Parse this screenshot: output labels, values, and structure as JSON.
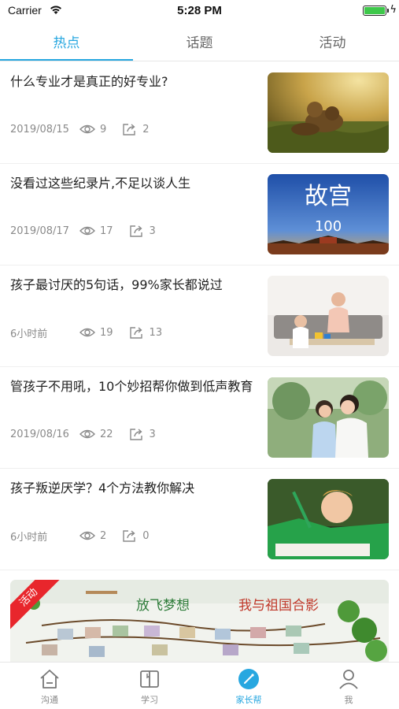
{
  "status_bar": {
    "carrier": "Carrier",
    "time": "5:28 PM",
    "battery_percent": 100,
    "battery_color": "#3ec84a"
  },
  "top_tabs": [
    {
      "label": "热点",
      "active": true
    },
    {
      "label": "话题",
      "active": false
    },
    {
      "label": "活动",
      "active": false
    }
  ],
  "accent_color": "#27a7e0",
  "articles": [
    {
      "title": "什么专业才是真正的好专业?",
      "date": "2019/08/15",
      "views": "9",
      "shares": "2",
      "image": "lions-at-sunset"
    },
    {
      "title": "没看过这些纪录片,不足以谈人生",
      "date": "2019/08/17",
      "views": "17",
      "shares": "3",
      "image": "forbidden-city-poster",
      "image_text": [
        "故宫",
        "100"
      ]
    },
    {
      "title": "孩子最讨厌的5句话，99%家长都说过",
      "date": "6小时前",
      "views": "19",
      "shares": "13",
      "image": "mother-and-child-at-table"
    },
    {
      "title": "管孩子不用吼，10个妙招帮你做到低声教育",
      "date": "2019/08/16",
      "views": "22",
      "shares": "3",
      "image": "mother-and-daughter-outdoors"
    },
    {
      "title": "孩子叛逆厌学？4个方法教你解决",
      "date": "6小时前",
      "views": "2",
      "shares": "0",
      "image": "sleepy-boy-writing"
    }
  ],
  "banner": {
    "ribbon": "活动",
    "text_left": "放飞梦想",
    "text_right": "我与祖国合影",
    "image": "photo-wall-with-vines"
  },
  "bottom_nav": [
    {
      "label": "沟通",
      "icon": "home-icon",
      "active": false
    },
    {
      "label": "学习",
      "icon": "book-icon",
      "active": false
    },
    {
      "label": "家长帮",
      "icon": "compass-icon",
      "active": true
    },
    {
      "label": "我",
      "icon": "person-icon",
      "active": false
    }
  ]
}
